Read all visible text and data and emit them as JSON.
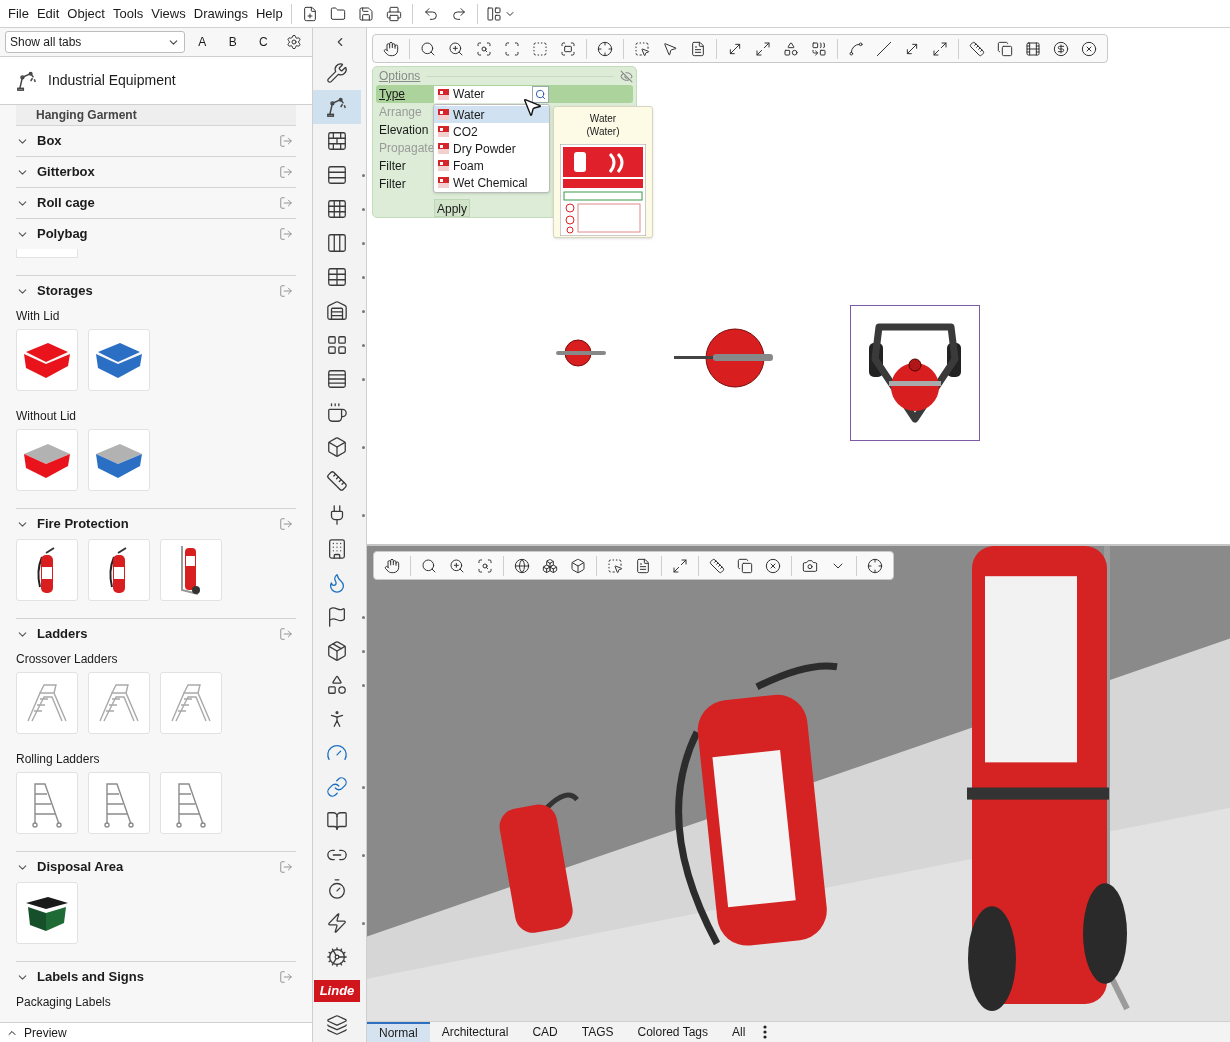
{
  "menu": [
    "File",
    "Edit",
    "Object",
    "Tools",
    "Views",
    "Drawings",
    "Help"
  ],
  "sidebar": {
    "tab_filter": "Show all tabs",
    "letters": [
      "A",
      "B",
      "C"
    ],
    "title": "Industrial Equipment",
    "partial_section": "Hanging Garment",
    "sections": [
      {
        "title": "Box",
        "expanded": true
      },
      {
        "title": "Gitterbox",
        "expanded": true
      },
      {
        "title": "Roll cage",
        "expanded": true
      },
      {
        "title": "Polybag",
        "expanded": true,
        "groups": [
          {
            "items": [
              {
                "kind": "blank"
              }
            ]
          }
        ]
      },
      {
        "title": "Storages",
        "expanded": true,
        "groups": [
          {
            "label": "With Lid",
            "items": [
              {
                "kind": "crate",
                "color": "#e8131b"
              },
              {
                "kind": "crate",
                "color": "#2a6fc4"
              }
            ]
          },
          {
            "label": "Without Lid",
            "items": [
              {
                "kind": "open-crate",
                "color": "#e8131b"
              },
              {
                "kind": "open-crate",
                "color": "#2a6fc4"
              }
            ]
          }
        ]
      },
      {
        "title": "Fire Protection",
        "expanded": true,
        "groups": [
          {
            "items": [
              {
                "kind": "extinguisher"
              },
              {
                "kind": "extinguisher"
              },
              {
                "kind": "trolley-extinguisher"
              }
            ]
          }
        ]
      },
      {
        "title": "Ladders",
        "expanded": true,
        "groups": [
          {
            "label": "Crossover Ladders",
            "items": [
              {
                "kind": "ladder"
              },
              {
                "kind": "ladder"
              },
              {
                "kind": "ladder"
              }
            ]
          },
          {
            "label": "Rolling Ladders",
            "items": [
              {
                "kind": "rolling-ladder"
              },
              {
                "kind": "rolling-ladder"
              },
              {
                "kind": "rolling-ladder"
              }
            ]
          }
        ]
      },
      {
        "title": "Disposal Area",
        "expanded": true,
        "groups": [
          {
            "items": [
              {
                "kind": "bin"
              }
            ]
          }
        ]
      },
      {
        "title": "Labels and Signs",
        "expanded": true,
        "groups": [
          {
            "label": "Packaging Labels"
          }
        ]
      }
    ],
    "preview": "Preview"
  },
  "tool_strip": [
    {
      "selected": false,
      "submenu": false
    },
    {
      "selected": true,
      "submenu": false
    },
    {
      "selected": false,
      "submenu": false
    },
    {
      "selected": false,
      "submenu": true
    },
    {
      "selected": false,
      "submenu": true
    },
    {
      "selected": false,
      "submenu": true
    },
    {
      "selected": false,
      "submenu": true
    },
    {
      "selected": false,
      "submenu": true
    },
    {
      "selected": false,
      "submenu": true
    },
    {
      "selected": false,
      "submenu": true
    },
    {
      "selected": false,
      "submenu": false
    },
    {
      "selected": false,
      "submenu": true
    },
    {
      "selected": false,
      "submenu": false
    },
    {
      "selected": false,
      "submenu": true
    },
    {
      "selected": false,
      "submenu": false
    },
    {
      "selected": false,
      "submenu": false
    },
    {
      "selected": false,
      "submenu": true
    },
    {
      "selected": false,
      "submenu": true
    },
    {
      "selected": false,
      "submenu": true
    },
    {
      "selected": false,
      "submenu": false
    },
    {
      "selected": false,
      "submenu": false
    },
    {
      "selected": false,
      "submenu": true
    },
    {
      "selected": false,
      "submenu": false
    },
    {
      "selected": false,
      "submenu": true
    },
    {
      "selected": false,
      "submenu": false
    },
    {
      "selected": false,
      "submenu": true
    },
    {
      "selected": false,
      "submenu": false
    },
    {
      "selected": false,
      "submenu": false,
      "logo_text": "Linde"
    },
    {
      "selected": false,
      "submenu": false
    }
  ],
  "options": {
    "title": "Options",
    "type_value": "Water",
    "apply": "Apply",
    "rows": [
      {
        "label": "Type",
        "selected": true,
        "disabled": false
      },
      {
        "label": "Arrange",
        "selected": false,
        "disabled": true
      },
      {
        "label": "Elevation",
        "selected": false,
        "disabled": false
      },
      {
        "label": "Propagate",
        "selected": false,
        "disabled": true
      },
      {
        "label": "Filter",
        "selected": false,
        "disabled": false
      },
      {
        "label": "Filter",
        "selected": false,
        "disabled": false
      }
    ]
  },
  "type_dropdown": [
    {
      "label": "Water",
      "selected": true
    },
    {
      "label": "CO2",
      "selected": false
    },
    {
      "label": "Dry Powder",
      "selected": false
    },
    {
      "label": "Foam",
      "selected": false
    },
    {
      "label": "Wet Chemical",
      "selected": false
    }
  ],
  "tooltip": {
    "title": "Water",
    "subtitle": "(Water)"
  },
  "plan_objects": [
    {
      "kind": "small-extinguisher",
      "selected": false
    },
    {
      "kind": "extinguisher",
      "selected": false
    },
    {
      "kind": "trolley-extinguisher",
      "selected": true
    }
  ],
  "view_tabs": [
    {
      "label": "Normal",
      "selected": true
    },
    {
      "label": "Architectural",
      "selected": false
    },
    {
      "label": "CAD",
      "selected": false
    },
    {
      "label": "TAGS",
      "selected": false
    },
    {
      "label": "Colored Tags",
      "selected": false
    },
    {
      "label": "All",
      "selected": false
    }
  ]
}
